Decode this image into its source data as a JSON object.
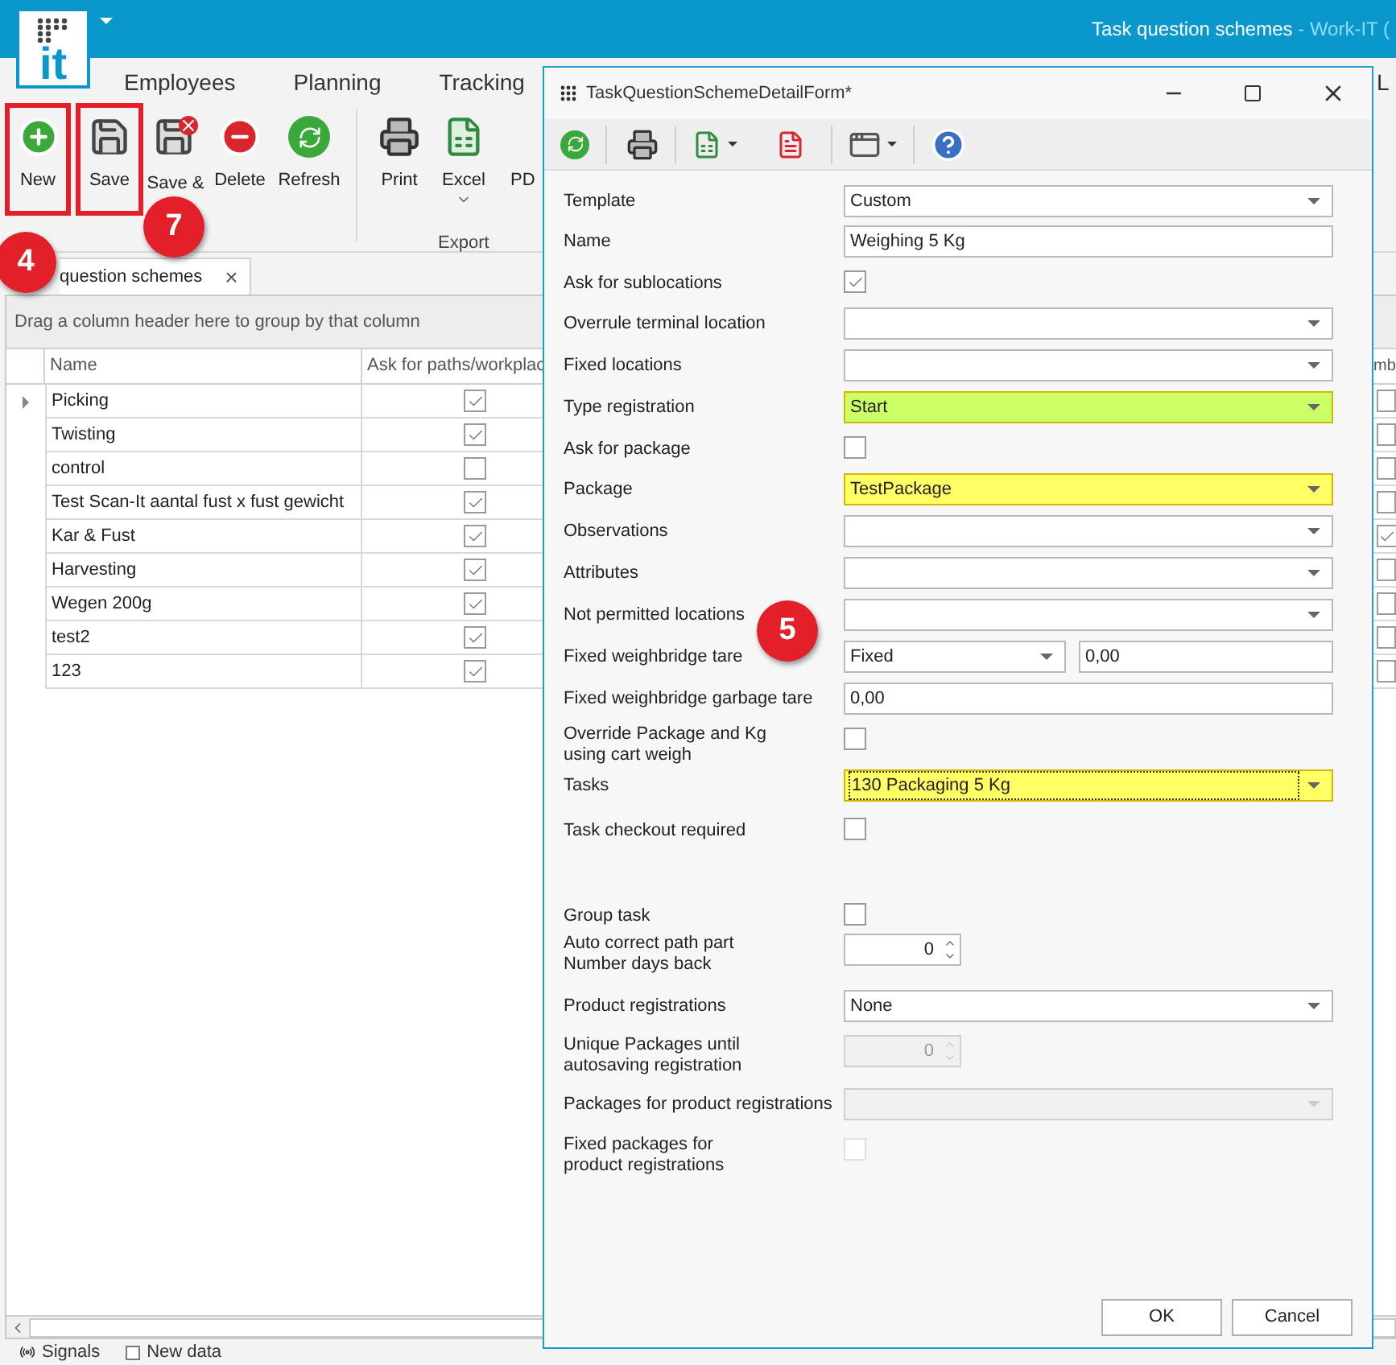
{
  "app": {
    "logo_text": "it",
    "title": "Task question schemes",
    "title_suffix": " - Work-IT ("
  },
  "ribbon_tabs": [
    {
      "label": "Employees"
    },
    {
      "label": "Planning"
    },
    {
      "label": "Tracking"
    },
    {
      "label": "L"
    }
  ],
  "ribbon_buttons": [
    {
      "kind": "new",
      "label": "New",
      "outlined": true
    },
    {
      "kind": "save",
      "label": "Save",
      "outlined": true
    },
    {
      "kind": "save_close",
      "label": "Save &",
      "outlined": false
    },
    {
      "kind": "delete",
      "label": "Delete",
      "outlined": false
    },
    {
      "kind": "refresh",
      "label": "Refresh",
      "outlined": false
    },
    {
      "kind": "print",
      "label": "Print",
      "outlined": false
    },
    {
      "kind": "excel",
      "label": "Excel",
      "outlined": false
    },
    {
      "kind": "pdf",
      "label": "PD",
      "outlined": false
    }
  ],
  "ribbon_group": "Export",
  "document_tab": {
    "label": "question schemes",
    "close": "×"
  },
  "grid": {
    "group_hint": "Drag a column header here to group by that column",
    "columns": [
      "Name",
      "Ask for paths/workplac"
    ],
    "column_3": "mb",
    "rows": [
      {
        "name": "Picking",
        "ask": true,
        "column_3": false,
        "selected": true
      },
      {
        "name": "Twisting",
        "ask": true,
        "column_3": false,
        "selected": false
      },
      {
        "name": "control",
        "ask": false,
        "column_3": false,
        "selected": false
      },
      {
        "name": "Test Scan-It aantal fust x fust gewicht",
        "ask": true,
        "column_3": false,
        "selected": false
      },
      {
        "name": "Kar & Fust",
        "ask": true,
        "column_3": true,
        "selected": false
      },
      {
        "name": "Harvesting",
        "ask": true,
        "column_3": false,
        "selected": false
      },
      {
        "name": "Wegen 200g",
        "ask": true,
        "column_3": false,
        "selected": false
      },
      {
        "name": "test2",
        "ask": true,
        "column_3": false,
        "selected": false
      },
      {
        "name": "123",
        "ask": true,
        "column_3": false,
        "selected": false
      }
    ]
  },
  "status_bar": [
    {
      "kind": "signals",
      "label": "Signals"
    },
    {
      "kind": "new_data",
      "label": "New data",
      "checked": false
    }
  ],
  "dialog": {
    "title": "TaskQuestionSchemeDetailForm*",
    "fields": [
      {
        "kind": "combo",
        "label": "Template",
        "value": "Custom"
      },
      {
        "kind": "text",
        "label": "Name",
        "value": "Weighing 5 Kg"
      },
      {
        "kind": "check",
        "label": "Ask for sublocations",
        "checked": true,
        "disabled": false
      },
      {
        "kind": "combo",
        "label": "Overrule terminal location"
      },
      {
        "kind": "combo",
        "label": "Fixed locations"
      },
      {
        "kind": "combo",
        "label": "Type registration",
        "value": "Start",
        "color": "#ccff66"
      },
      {
        "kind": "check",
        "label": "Ask for package",
        "checked": false,
        "disabled": false
      },
      {
        "kind": "combo",
        "label": "Package",
        "value": "TestPackage",
        "color": "#ffff66"
      },
      {
        "kind": "combo",
        "label": "Observations"
      },
      {
        "kind": "combo",
        "label": "Attributes"
      },
      {
        "kind": "combo",
        "label": "Not permitted locations"
      },
      {
        "kind": "combo_text",
        "label": "Fixed weighbridge tare",
        "value": "Fixed",
        "value2": "0,00"
      },
      {
        "kind": "text",
        "label": "Fixed weighbridge garbage tare",
        "value": "0,00"
      },
      {
        "kind": "check",
        "label": "Override Package and Kg using cart weigh",
        "checked": false,
        "disabled": false
      },
      {
        "kind": "combo",
        "label": "Tasks",
        "value": "130 Packaging 5 Kg",
        "color": "#ffff66",
        "focused": true
      },
      {
        "kind": "check",
        "label": "Task checkout required",
        "checked": false,
        "disabled": false
      },
      {
        "kind": "check",
        "label": "Group task",
        "checked": false,
        "disabled": false
      },
      {
        "kind": "spin",
        "label": "Auto correct path part Number days back",
        "value": "0",
        "disabled": false
      },
      {
        "kind": "combo",
        "label": "Product registrations",
        "value": "None"
      },
      {
        "kind": "spin",
        "label": "Unique Packages until autosaving registration",
        "value": "0",
        "disabled": true
      },
      {
        "kind": "combo",
        "label": "Packages for product registrations",
        "disabled": true
      },
      {
        "kind": "check",
        "label": "Fixed packages for product registrations",
        "checked": false,
        "disabled": true
      }
    ],
    "buttons": [
      "OK",
      "Cancel"
    ]
  },
  "annotations": [
    {
      "label": "4"
    },
    {
      "label": "7"
    },
    {
      "label": "5"
    }
  ]
}
